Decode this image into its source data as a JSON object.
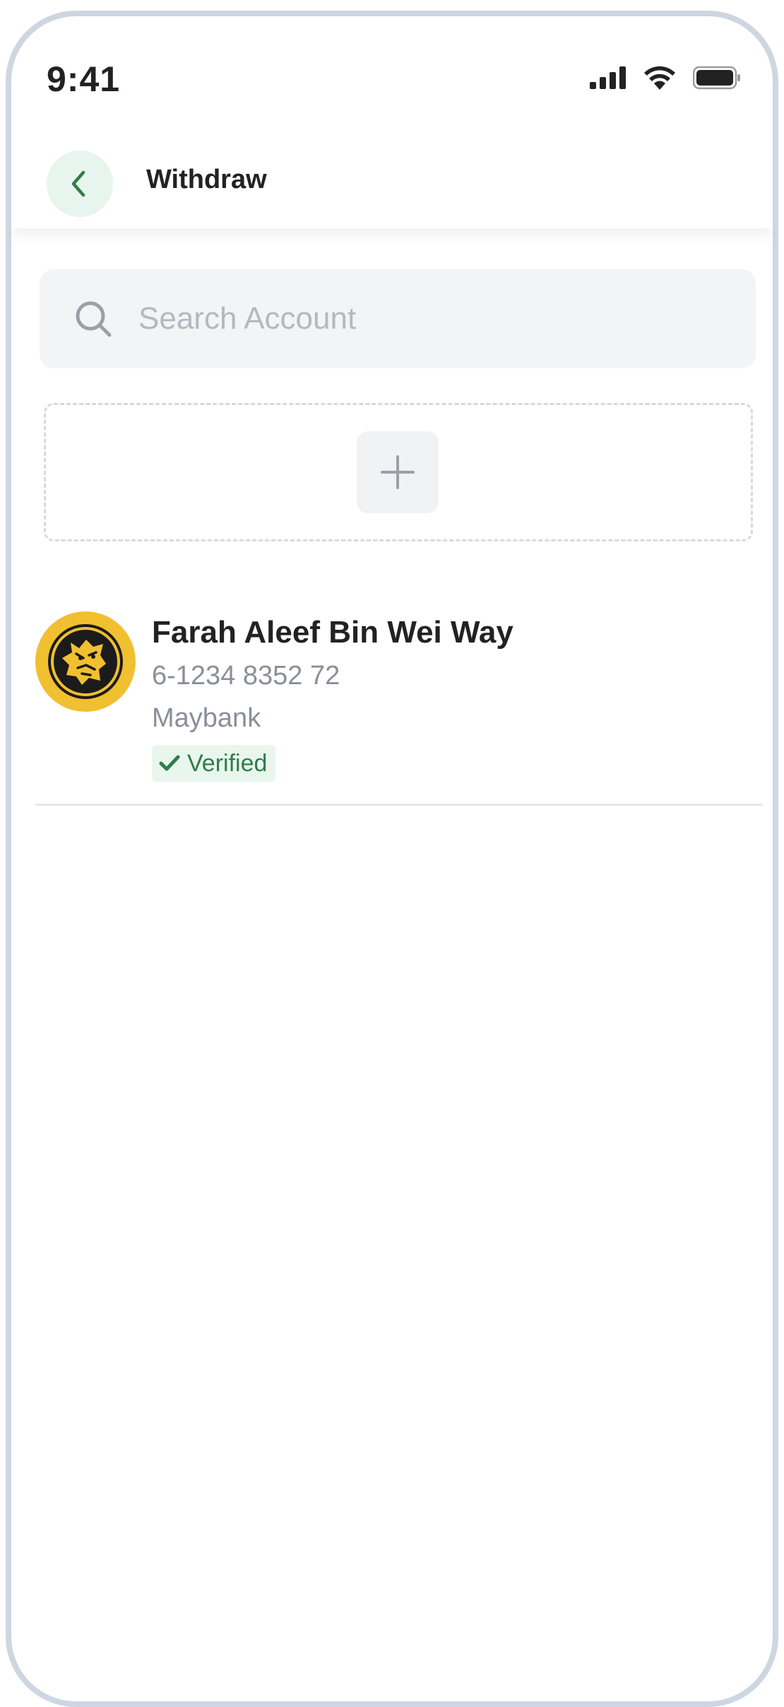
{
  "status_bar": {
    "time": "9:41",
    "icons": [
      "signal-icon",
      "wifi-icon",
      "battery-icon"
    ]
  },
  "header": {
    "title": "Withdraw",
    "back_icon": "chevron-left-icon"
  },
  "search": {
    "placeholder": "Search Account",
    "value": ""
  },
  "add_account": {
    "icon": "plus-icon"
  },
  "accounts": [
    {
      "name": "Farah Aleef Bin Wei Way",
      "number": "6-1234 8352 72",
      "bank": "Maybank",
      "status": "Verified",
      "logo_icon": "maybank-tiger-logo"
    }
  ],
  "colors": {
    "accent": "#2f7d4a",
    "back_bg": "#e7f5ee",
    "logo_bg": "#f1c030"
  }
}
